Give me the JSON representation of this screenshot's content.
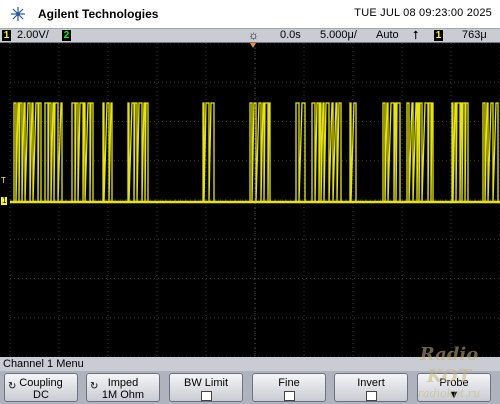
{
  "header": {
    "brand": "Agilent Technologies",
    "datetime": "TUE JUL 08 09:23:00 2025"
  },
  "status": {
    "ch1_num": "1",
    "ch1_scale": "2.00V/",
    "ch2_num": "2",
    "time_offset": "0.0s",
    "time_scale": "5.000μ/",
    "trigger_mode": "Auto",
    "trigger_channel": "1",
    "trigger_level": "763μ"
  },
  "screen": {
    "trigger_marker": "T",
    "ground_marker": "1"
  },
  "menu": {
    "title": "Channel 1  Menu",
    "softkeys": [
      {
        "label": "Coupling",
        "value": "DC"
      },
      {
        "label": "Imped",
        "value": "1M Ohm"
      },
      {
        "label": "BW Limit",
        "value": ""
      },
      {
        "label": "Fine",
        "value": ""
      },
      {
        "label": "Invert",
        "value": ""
      },
      {
        "label": "Probe",
        "value": ""
      }
    ]
  },
  "watermark": {
    "line1": "Radio KOT",
    "line2": "radiokot.ru"
  },
  "colors": {
    "trace": "#e8e600",
    "background": "#000000",
    "grid": "#3a3a3a"
  }
}
